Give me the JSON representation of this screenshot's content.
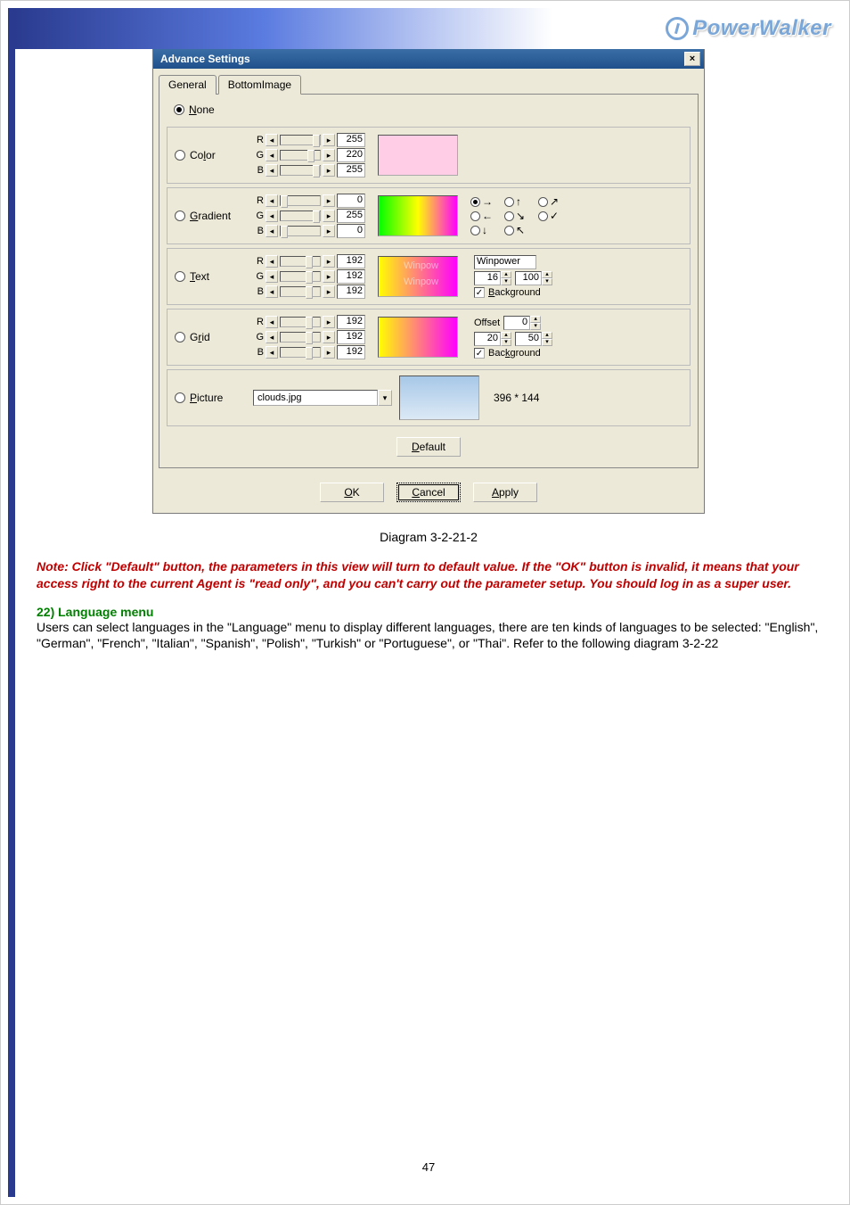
{
  "brand": "PowerWalker",
  "dialog": {
    "title": "Advance Settings",
    "close": "×",
    "tabs": [
      "General",
      "BottomImage"
    ],
    "activeTab": "BottomImage"
  },
  "rows": {
    "none": {
      "label": "None",
      "checked": true
    },
    "color": {
      "label": "Color",
      "R": "255",
      "G": "220",
      "B": "255"
    },
    "gradient": {
      "label": "Gradient",
      "R": "0",
      "G": "255",
      "B": "0",
      "dirs": [
        "→",
        "↑",
        "↗",
        "←",
        "↘",
        "✓",
        "↓",
        "↖"
      ]
    },
    "text": {
      "label": "Text",
      "R": "192",
      "G": "192",
      "B": "192",
      "watermark": "Winpow",
      "caption": "Winpower",
      "size1": "16",
      "size2": "100",
      "bgLabel": "Background",
      "bgChecked": true
    },
    "grid": {
      "label": "Grid",
      "R": "192",
      "G": "192",
      "B": "192",
      "offsetLabel": "Offset",
      "o1": "0",
      "o2": "20",
      "o3": "50",
      "bgLabel": "Background",
      "bgChecked": true
    },
    "picture": {
      "label": "Picture",
      "file": "clouds.jpg",
      "dims": "396 * 144"
    }
  },
  "buttons": {
    "default": "Default",
    "ok": "OK",
    "cancel": "Cancel",
    "apply": "Apply"
  },
  "caption": "Diagram 3-2-21-2",
  "note": "Note: Click \"Default\" button, the parameters in this view will turn to default value. If the \"OK\" button is invalid, it means that your access right to the current Agent is \"read only\", and you can't carry out the parameter setup. You should log in as a super user.",
  "section": "22) Language menu",
  "para": "Users can select languages in the \"Language\" menu to display different languages, there are ten kinds of languages to be selected: \"English\", \"German\", \"French\", \"Italian\", \"Spanish\", \"Polish\", \"Turkish\" or \"Portuguese\", or \"Thai\". Refer to the following diagram 3-2-22",
  "pagenum": "47"
}
